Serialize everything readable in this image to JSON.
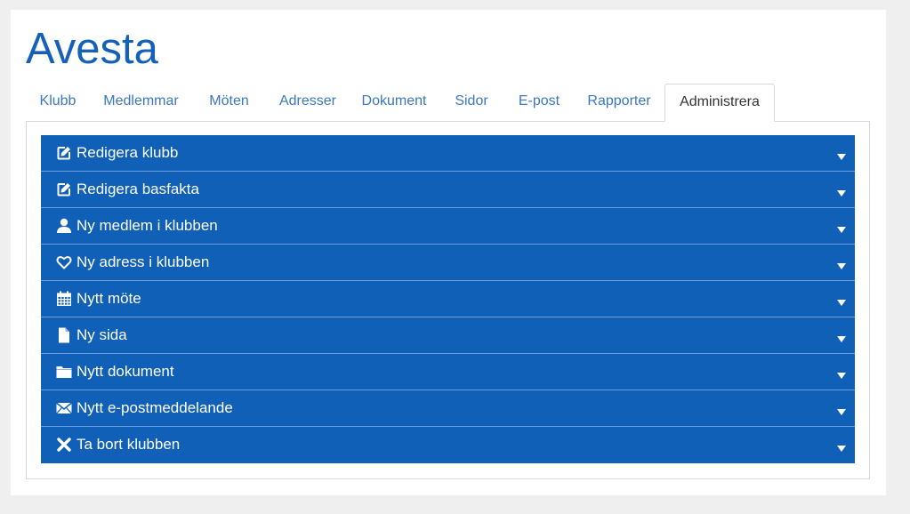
{
  "app": {
    "title": "Avesta"
  },
  "tabs": [
    {
      "label": "Klubb"
    },
    {
      "label": "Medlemmar"
    },
    {
      "label": "Möten"
    },
    {
      "label": "Adresser"
    },
    {
      "label": "Dokument"
    },
    {
      "label": "Sidor"
    },
    {
      "label": "E-post"
    },
    {
      "label": "Rapporter"
    },
    {
      "label": "Administrera",
      "active": true
    }
  ],
  "accordion": [
    {
      "label": "Redigera klubb",
      "icon": "edit-icon"
    },
    {
      "label": "Redigera basfakta",
      "icon": "edit-icon"
    },
    {
      "label": "Ny medlem i klubben",
      "icon": "user-icon"
    },
    {
      "label": "Ny adress i klubben",
      "icon": "heart-icon"
    },
    {
      "label": "Nytt möte",
      "icon": "calendar-icon"
    },
    {
      "label": "Ny sida",
      "icon": "file-icon"
    },
    {
      "label": "Nytt dokument",
      "icon": "folder-icon"
    },
    {
      "label": "Nytt e-postmeddelande",
      "icon": "envelope-icon"
    },
    {
      "label": "Ta bort klubben",
      "icon": "close-icon"
    }
  ],
  "colors": {
    "brand": "#1561b8",
    "accordion_bg": "#1060b8",
    "tab_link": "#3c78bf",
    "page_bg": "#efefef"
  }
}
